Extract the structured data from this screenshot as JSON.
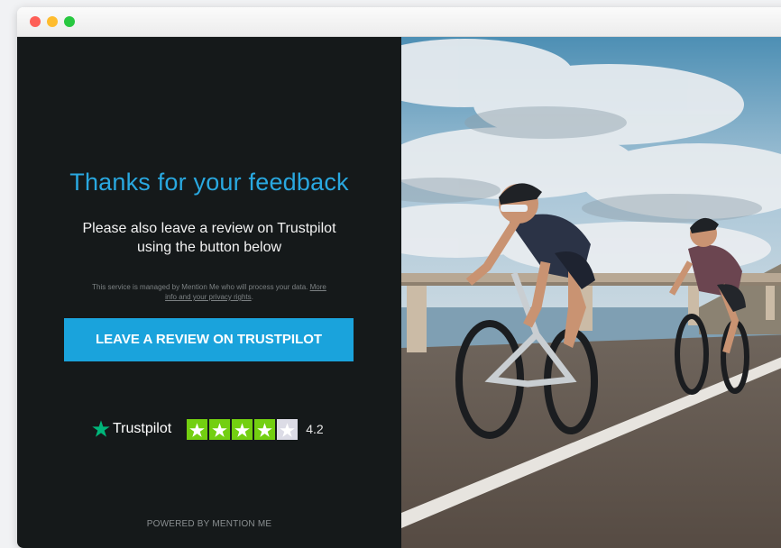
{
  "window": {
    "buttons": [
      "close",
      "minimize",
      "maximize"
    ]
  },
  "card": {
    "headline": "Thanks for your feedback",
    "subtext_line1": "Please also leave a review on Trustpilot",
    "subtext_line2": "using the button below",
    "disclaimer_text": "This service is managed by Mention Me who will process your data.",
    "disclaimer_link": "More info and your privacy rights",
    "disclaimer_end": ".",
    "cta_label": "LEAVE A REVIEW ON TRUSTPILOT",
    "trustpilot_name": "Trustpilot",
    "rating_value": "4.2",
    "rating_stars_filled": 4,
    "rating_stars_total": 5,
    "powered_by": "POWERED BY MENTION ME"
  },
  "colors": {
    "panel_bg": "#15191a",
    "accent_blue": "#1aa3dc",
    "headline_blue": "#29a8e0",
    "trustpilot_green": "#00b67a",
    "star_green": "#73cf11",
    "star_empty": "#dcdce6"
  },
  "icons": {
    "trustpilot_logo": "trustpilot-star-icon",
    "rating_star": "star-icon"
  },
  "image": {
    "description_alt": ""
  }
}
